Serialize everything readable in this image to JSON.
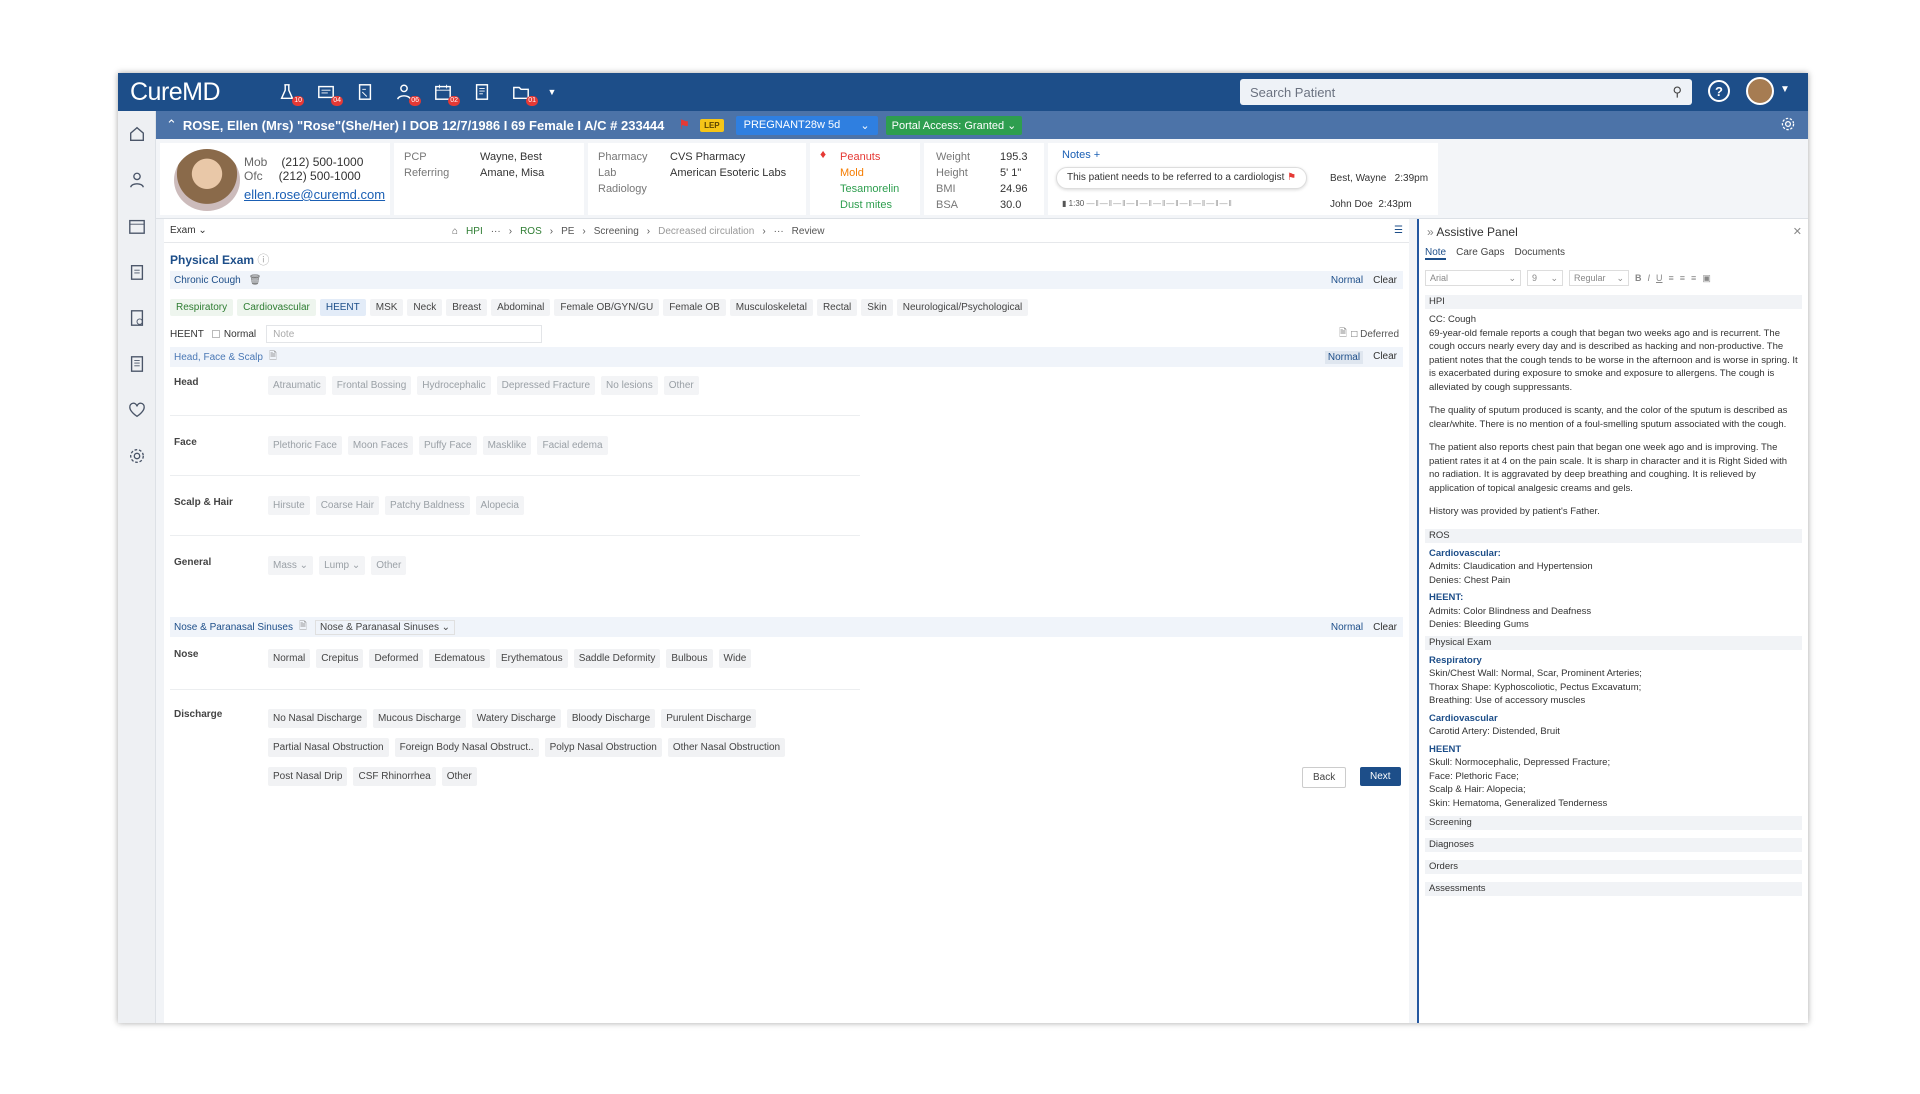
{
  "app": {
    "logo": "CureMD"
  },
  "nav": {
    "badges": [
      "10",
      "04",
      "",
      "06",
      "02",
      "",
      "01"
    ],
    "search_placeholder": "Search Patient"
  },
  "patient": {
    "header": "ROSE, Ellen (Mrs) \"Rose\"(She/Her) I DOB 12/7/1986 I 69 Female I A/C # 233444",
    "lep": "LEP",
    "pregnancy": "PREGNANT28w 5d",
    "portal": "Portal Access: Granted",
    "mob_label": "Mob",
    "mob": "(212) 500-1000",
    "ofc_label": "Ofc",
    "ofc": "(212) 500-1000",
    "email": "ellen.rose@curemd.com",
    "pcp_label": "PCP",
    "pcp": "Wayne, Best",
    "referring_label": "Referring",
    "referring": "Amane, Misa",
    "pharmacy_label": "Pharmacy",
    "pharmacy": "CVS Pharmacy",
    "lab_label": "Lab",
    "lab": "American Esoteric Labs",
    "radiology_label": "Radiology",
    "allergies": [
      "Peanuts",
      "Mold",
      "Tesamorelin",
      "Dust mites"
    ],
    "allergy_colors": [
      "#e53935",
      "#f57c00",
      "#2e9e4f",
      "#2e9e4f"
    ],
    "vitals": [
      {
        "label": "Weight",
        "value": "195.3"
      },
      {
        "label": "Height",
        "value": "5' 1\""
      },
      {
        "label": "BMI",
        "value": "24.96"
      },
      {
        "label": "BSA",
        "value": "30.0"
      }
    ],
    "notes_label": "Notes +",
    "note_text": "This patient needs to be referred to a cardiologist",
    "note_author": "Best, Wayne",
    "note_time": "2:39pm",
    "note2_author": "John Doe",
    "note2_time": "2:43pm",
    "audio_time": "1:30"
  },
  "exam": {
    "dropdown": "Exam",
    "breadcrumb": [
      "HPI",
      "···",
      "ROS",
      "PE",
      "Screening",
      "Decreased circulation",
      "···",
      "Review"
    ],
    "title": "Physical Exam",
    "complaint": "Chronic Cough",
    "normal": "Normal",
    "clear": "Clear",
    "tabs": [
      "Respiratory",
      "Cardiovascular",
      "HEENT",
      "MSK",
      "Neck",
      "Breast",
      "Abdominal",
      "Female OB/GYN/GU",
      "Female OB",
      "Musculoskeletal",
      "Rectal",
      "Skin",
      "Neurological/Psychological"
    ],
    "heent_label": "HEENT",
    "heent_normal": "Normal",
    "note_placeholder": "Note",
    "deferred": "Deferred",
    "section1": "Head, Face & Scalp",
    "head_label": "Head",
    "head": [
      "Atraumatic",
      "Frontal Bossing",
      "Hydrocephalic",
      "Depressed Fracture",
      "No lesions",
      "Other"
    ],
    "face_label": "Face",
    "face": [
      "Plethoric Face",
      "Moon Faces",
      "Puffy Face",
      "Masklike",
      "Facial edema"
    ],
    "scalp_label": "Scalp & Hair",
    "scalp": [
      "Hirsute",
      "Coarse Hair",
      "Patchy Baldness",
      "Alopecia"
    ],
    "general_label": "General",
    "general": [
      "Mass",
      "Lump",
      "Other"
    ],
    "section2": "Nose & Paranasal Sinuses",
    "section2_select": "Nose & Paranasal Sinuses",
    "nose_label": "Nose",
    "nose": [
      "Normal",
      "Crepitus",
      "Deformed",
      "Edematous",
      "Erythematous",
      "Saddle Deformity",
      "Bulbous",
      "Wide"
    ],
    "discharge_label": "Discharge",
    "discharge": [
      "No Nasal Discharge",
      "Mucous Discharge",
      "Watery Discharge",
      "Bloody Discharge",
      "Purulent Discharge",
      "Partial Nasal Obstruction",
      "Foreign Body Nasal Obstruct..",
      "Polyp Nasal Obstruction",
      "Other Nasal Obstruction",
      "Post Nasal Drip",
      "CSF Rhinorrhea",
      "Other"
    ],
    "back": "Back",
    "next": "Next"
  },
  "assist": {
    "title": "Assistive Panel",
    "tabs": [
      "Note",
      "Care Gaps",
      "Documents"
    ],
    "font": "Arial",
    "size": "9",
    "weight": "Regular",
    "hpi": "HPI",
    "cc": "CC: Cough",
    "p1": "69-year-old female reports a cough that began two weeks ago and is recurrent. The cough occurs nearly every day and is described as hacking and non-productive. The patient notes that the cough tends to be worse in the afternoon and is worse in spring. It is exacerbated during exposure to smoke and exposure to allergens. The cough is alleviated by cough suppressants.",
    "p2": "The quality of sputum produced is scanty, and the color of the sputum is described as clear/white. There is no mention of a foul-smelling sputum associated with the cough.",
    "p3": "The patient also reports chest pain that began one week ago and is improving. The patient rates it at 4 on the pain scale. It is sharp in character and it is Right Sided with no radiation. It is aggravated by deep breathing and coughing. It is relieved by application of topical analgesic creams and gels.",
    "p4": "History was provided by patient's Father.",
    "ros": "ROS",
    "ros_cv": "Cardiovascular:",
    "ros_cv1": "Admits: Claudication and Hypertension",
    "ros_cv2": "Denies: Chest Pain",
    "ros_heent": "HEENT:",
    "ros_h1": "Admits: Color Blindness and Deafness",
    "ros_h2": "Denies: Bleeding Gums",
    "pe": "Physical Exam",
    "pe_resp": "Respiratory",
    "pe_r1": "Skin/Chest Wall: Normal, Scar, Prominent Arteries;",
    "pe_r2": "Thorax Shape: Kyphoscoliotic, Pectus Excavatum;",
    "pe_r3": "Breathing: Use of accessory muscles",
    "pe_cv": "Cardiovascular",
    "pe_c1": "Carotid Artery: Distended, Bruit",
    "pe_heent": "HEENT",
    "pe_h1": "Skull: Normocephalic, Depressed Fracture;",
    "pe_h2": "Face: Plethoric Face;",
    "pe_h3": "Scalp & Hair: Alopecia;",
    "pe_h4": "Skin: Hematoma, Generalized Tenderness",
    "screening": "Screening",
    "diagnoses": "Diagnoses",
    "orders": "Orders",
    "assessments": "Assessments"
  }
}
